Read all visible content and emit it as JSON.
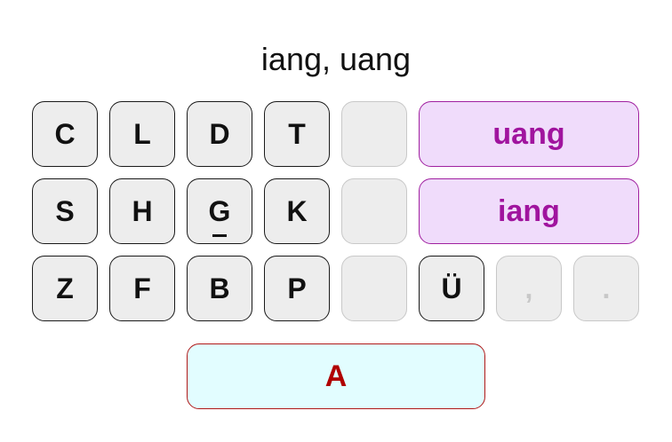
{
  "header": {
    "title": "iang, uang"
  },
  "keyboard": {
    "row1": [
      "C",
      "L",
      "D",
      "T"
    ],
    "row2": [
      "S",
      "H",
      "G",
      "K"
    ],
    "row3": [
      "Z",
      "F",
      "B",
      "P"
    ],
    "umlaut_key": "Ü",
    "comma_key": ",",
    "period_key": ".",
    "finals": [
      "uang",
      "iang"
    ],
    "space_key": "A"
  },
  "colors": {
    "final_bg": "#f0dcfb",
    "final_text": "#a0149e",
    "space_bg": "#e2fdff",
    "space_text": "#b00000",
    "key_bg": "#ededed"
  }
}
